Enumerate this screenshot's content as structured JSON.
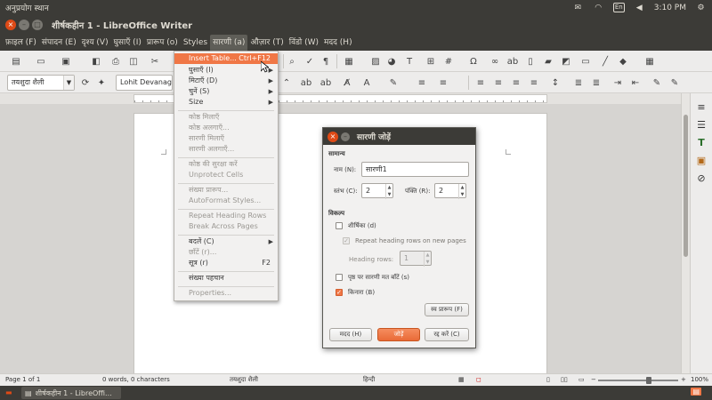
{
  "system_panel": {
    "menu_left": "अनुप्रयोग  स्थान",
    "keyboard": "En",
    "clock": "3:10 PM"
  },
  "window": {
    "title": "शीर्षकहीन 1 - LibreOffice Writer"
  },
  "menubar": {
    "items": [
      "फ़ाइल (F)",
      "संपादन (E)",
      "दृश्य (V)",
      "घुसाएँ (I)",
      "प्रारूप (o)",
      "Styles",
      "सारणी (a)",
      "औज़ार (T)",
      "विंडो (W)",
      "मदद (H)"
    ]
  },
  "toolbar2": {
    "paragraph_style": "तयशुदा शैली",
    "font_name": "Lohit Devanagar"
  },
  "table_menu": {
    "insert_table": "Insert Table...",
    "insert_table_shortcut": "Ctrl+F12",
    "insert": "घुसाएँ (I)",
    "delete": "मिटाएँ (D)",
    "select": "चुनें (S)",
    "size": "Size",
    "merge_cells": "कोष्ठ मिलाएँ",
    "split_cells": "कोष्ठ अलगाएँ...",
    "merge_table": "सारणी मिलाएँ",
    "split_table": "सारणी अलगाएँ...",
    "protect_cells": "कोष्ठ की सुरक्षा करें",
    "unprotect_cells": "Unprotect Cells",
    "number_format": "संख्या प्रारूप...",
    "autoformat": "AutoFormat Styles...",
    "repeat_heading": "Repeat Heading Rows",
    "break_across": "Break Across Pages",
    "convert": "बदलें (C)",
    "sort": "छाँटें (r)...",
    "formula": "सूत्र (r)",
    "formula_shortcut": "F2",
    "number_recognition": "संख्या पहचान",
    "properties": "Properties..."
  },
  "dialog": {
    "title": "सारणी जोड़ें",
    "section_general": "सामान्य",
    "name_label": "नाम (N):",
    "name_value": "सारणी1",
    "columns_label": "स्तंभ (C):",
    "columns_value": "2",
    "rows_label": "पंक्ति (R):",
    "rows_value": "2",
    "section_options": "विकल्प",
    "heading_label": "शीर्षिका (d)",
    "repeat_heading_label": "Repeat heading rows on new pages",
    "heading_rows_label": "Heading rows:",
    "heading_rows_value": "1",
    "dont_split_label": "पृष्ठ पर सारणी मत बाँटें (s)",
    "border_label": "किनारा (B)",
    "autoformat_button": "स्व प्रारूप (F)",
    "help_button": "मदद (H)",
    "insert_button": "जोड़ें",
    "cancel_button": "रद्द करें (C)"
  },
  "statusbar": {
    "page": "Page 1 of 1",
    "words": "0 words, 0 characters",
    "style": "तयशुदा शैली",
    "language": "हिन्दी",
    "zoom": "100%"
  },
  "taskbar": {
    "task_label": "शीर्षकहीन 1 - LibreOffi..."
  },
  "colors": {
    "accent": "#f07746",
    "panel": "#3c3b37",
    "close": "#df4a16"
  }
}
